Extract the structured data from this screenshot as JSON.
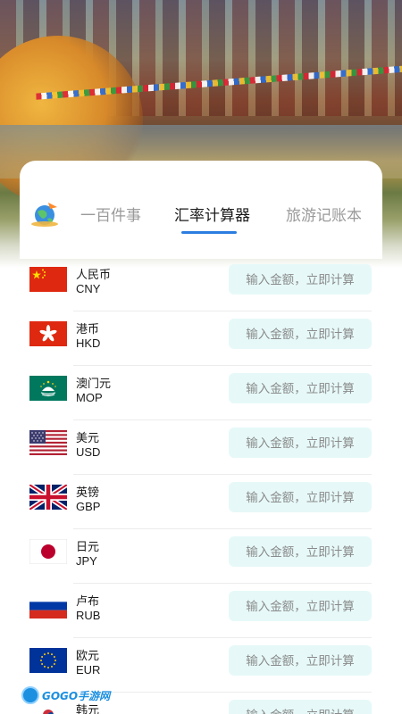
{
  "tabs": [
    {
      "label": "一百件事",
      "active": false
    },
    {
      "label": "汇率计算器",
      "active": true
    },
    {
      "label": "旅游记账本",
      "active": false
    }
  ],
  "accent_color": "#2b7de0",
  "input_bg_color": "#e6f9f8",
  "currencies": [
    {
      "name": "人民币",
      "code": "CNY",
      "flag": "china-flag-icon",
      "placeholder": "输入金额，立即计算"
    },
    {
      "name": "港币",
      "code": "HKD",
      "flag": "hong-kong-flag-icon",
      "placeholder": "输入金额，立即计算"
    },
    {
      "name": "澳门元",
      "code": "MOP",
      "flag": "macau-flag-icon",
      "placeholder": "输入金额，立即计算"
    },
    {
      "name": "美元",
      "code": "USD",
      "flag": "usa-flag-icon",
      "placeholder": "输入金额，立即计算"
    },
    {
      "name": "英镑",
      "code": "GBP",
      "flag": "uk-flag-icon",
      "placeholder": "输入金额，立即计算"
    },
    {
      "name": "日元",
      "code": "JPY",
      "flag": "japan-flag-icon",
      "placeholder": "输入金额，立即计算"
    },
    {
      "name": "卢布",
      "code": "RUB",
      "flag": "russia-flag-icon",
      "placeholder": "输入金额，立即计算"
    },
    {
      "name": "欧元",
      "code": "EUR",
      "flag": "eu-flag-icon",
      "placeholder": "输入金额，立即计算"
    },
    {
      "name": "韩元",
      "code": "",
      "flag": "korea-flag-icon",
      "placeholder": "输入金额，立即计算"
    }
  ],
  "watermark": {
    "text": "GOGO手游网"
  }
}
